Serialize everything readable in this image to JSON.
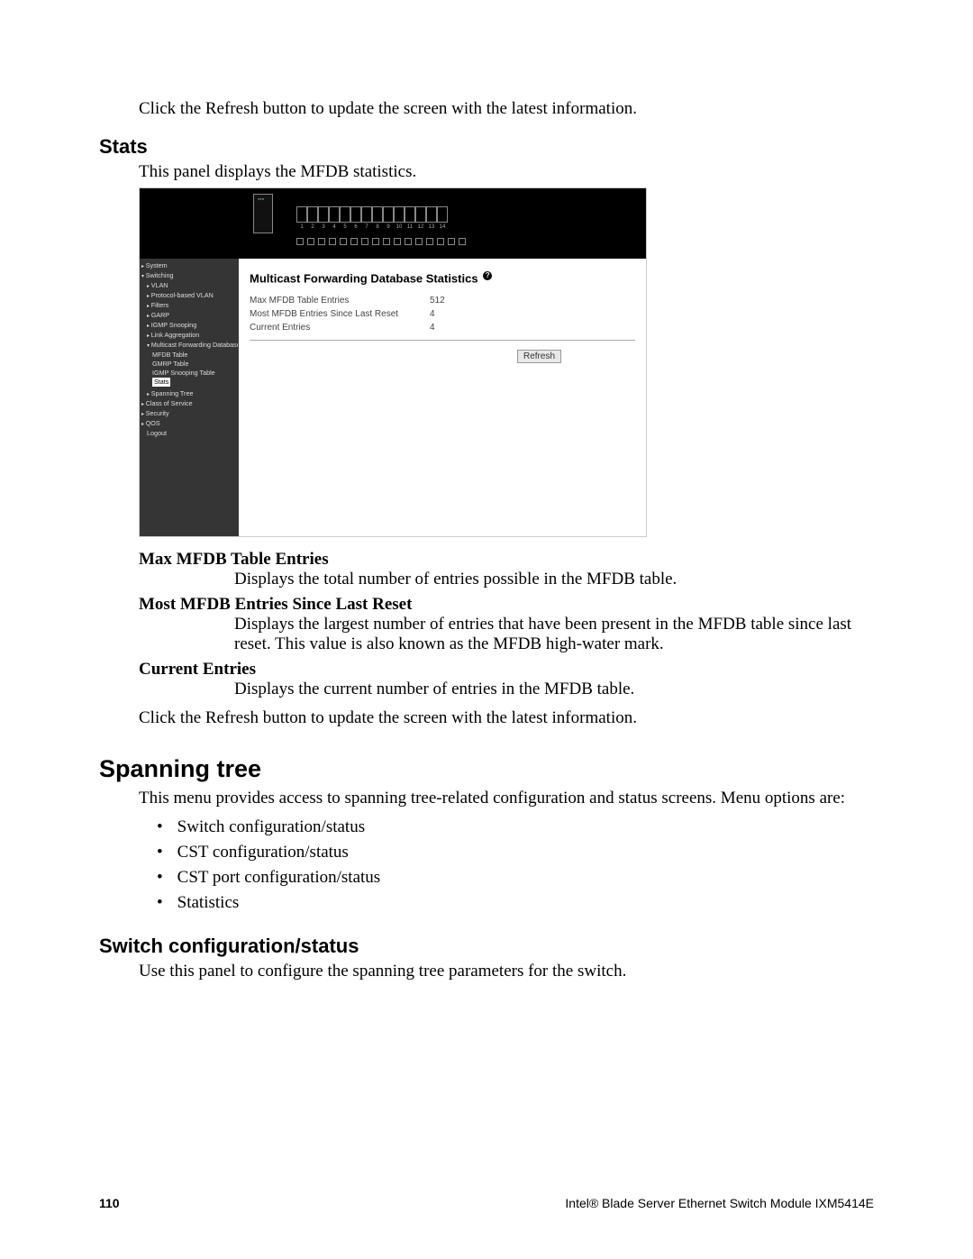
{
  "intro": "Click the Refresh button to update the screen with the latest information.",
  "stats": {
    "heading": "Stats",
    "desc": "This panel displays the MFDB statistics."
  },
  "panel": {
    "port_numbers": [
      "1",
      "2",
      "3",
      "4",
      "5",
      "6",
      "7",
      "8",
      "9",
      "10",
      "11",
      "12",
      "13",
      "14"
    ],
    "nav": {
      "system": "System",
      "switching": "Switching",
      "vlan": "VLAN",
      "protocol_vlan": "Protocol-based VLAN",
      "filters": "Filters",
      "garp": "GARP",
      "igmp": "IGMP Snooping",
      "link_agg": "Link Aggregation",
      "mfdb": "Multicast Forwarding Database",
      "mfdb_table": "MFDB Table",
      "gmrp_table": "GMRP Table",
      "igmp_snoop_table": "IGMP Snooping Table",
      "stats": "Stats",
      "spanning_tree": "Spanning Tree",
      "cos": "Class of Service",
      "security": "Security",
      "qos": "QOS",
      "logout": "Logout"
    },
    "content_title": "Multicast Forwarding Database Statistics",
    "rows": {
      "r1_label": "Max MFDB Table Entries",
      "r1_value": "512",
      "r2_label": "Most MFDB Entries Since Last Reset",
      "r2_value": "4",
      "r3_label": "Current Entries",
      "r3_value": "4"
    },
    "refresh": "Refresh"
  },
  "defs": {
    "d1_term": "Max MFDB Table Entries",
    "d1_def": "Displays the total number of entries possible in the MFDB table.",
    "d2_term": "Most MFDB Entries Since Last Reset",
    "d2_def": "Displays the largest number of entries that have been present in the MFDB table since last reset. This value is also known as the MFDB high-water mark.",
    "d3_term": "Current Entries",
    "d3_def": "Displays the current number of entries in the MFDB table."
  },
  "click_refresh": "Click the Refresh button to update the screen with the latest information.",
  "spanning_tree": {
    "heading": "Spanning tree",
    "desc": "This menu provides access to spanning tree-related configuration and status screens. Menu options are:",
    "items": {
      "i1": "Switch configuration/status",
      "i2": "CST configuration/status",
      "i3": "CST port configuration/status",
      "i4": "Statistics"
    }
  },
  "switch_config": {
    "heading": "Switch configuration/status",
    "desc": "Use this panel to configure the spanning tree parameters for the switch."
  },
  "footer": {
    "page": "110",
    "title": "Intel® Blade Server Ethernet Switch Module IXM5414E"
  },
  "chart_data": {
    "type": "table",
    "title": "Multicast Forwarding Database Statistics",
    "rows": [
      {
        "label": "Max MFDB Table Entries",
        "value": 512
      },
      {
        "label": "Most MFDB Entries Since Last Reset",
        "value": 4
      },
      {
        "label": "Current Entries",
        "value": 4
      }
    ]
  }
}
